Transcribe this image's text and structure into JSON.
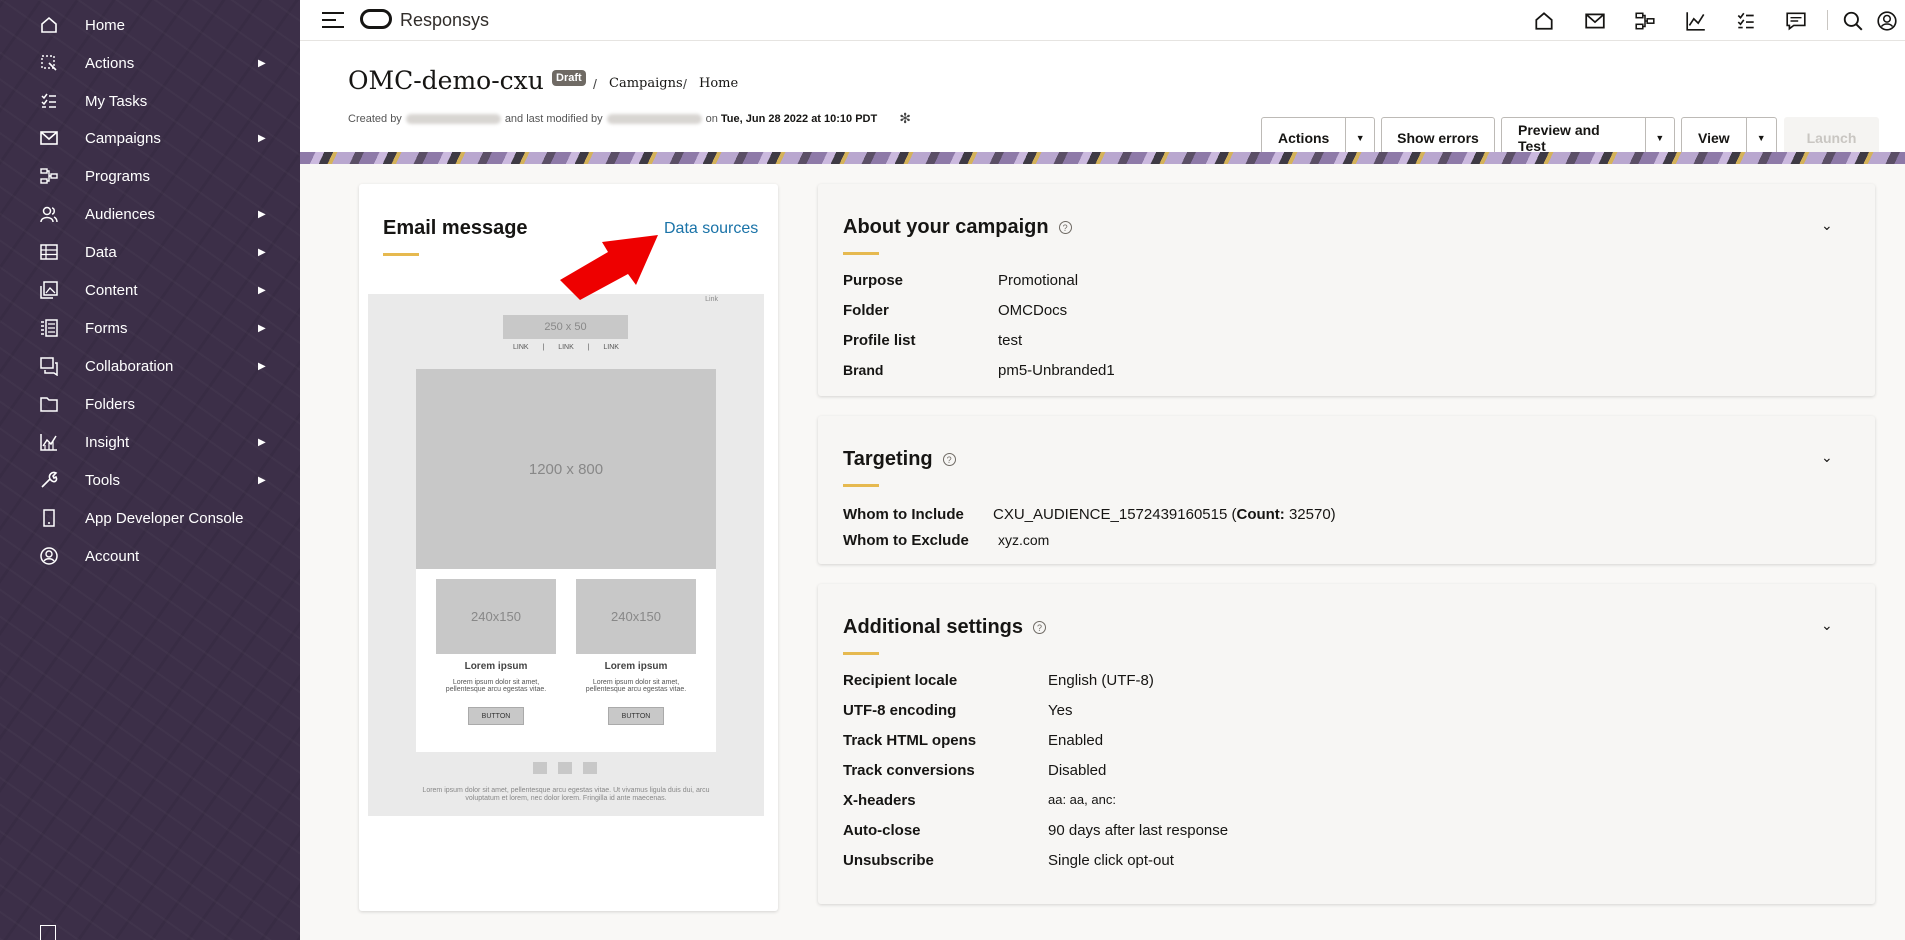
{
  "sidebar": {
    "items": [
      {
        "label": "Home",
        "icon": "home-icon",
        "submenu": false
      },
      {
        "label": "Actions",
        "icon": "actions-icon",
        "submenu": true
      },
      {
        "label": "My Tasks",
        "icon": "tasks-icon",
        "submenu": false
      },
      {
        "label": "Campaigns",
        "icon": "mail-icon",
        "submenu": true
      },
      {
        "label": "Programs",
        "icon": "programs-icon",
        "submenu": false
      },
      {
        "label": "Audiences",
        "icon": "audiences-icon",
        "submenu": true
      },
      {
        "label": "Data",
        "icon": "data-icon",
        "submenu": true
      },
      {
        "label": "Content",
        "icon": "content-icon",
        "submenu": true
      },
      {
        "label": "Forms",
        "icon": "forms-icon",
        "submenu": true
      },
      {
        "label": "Collaboration",
        "icon": "collaboration-icon",
        "submenu": true
      },
      {
        "label": "Folders",
        "icon": "folder-icon",
        "submenu": false
      },
      {
        "label": "Insight",
        "icon": "insight-icon",
        "submenu": true
      },
      {
        "label": "Tools",
        "icon": "wrench-icon",
        "submenu": true
      },
      {
        "label": "App Developer Console",
        "icon": "device-icon",
        "submenu": false
      },
      {
        "label": "Account",
        "icon": "account-icon",
        "submenu": false
      }
    ]
  },
  "topbar": {
    "brand": "Responsys",
    "icons": [
      "home-icon",
      "mail-icon",
      "programs-icon",
      "insight-icon",
      "tasks-icon",
      "chat-icon",
      "search-icon",
      "user-icon"
    ]
  },
  "header": {
    "title": "OMC-demo-cxu",
    "badge": "Draft",
    "breadcrumb_1": "Campaigns",
    "breadcrumb_2": "Home",
    "meta_created": "Created by",
    "meta_modified": "and last modified by",
    "meta_on": "on",
    "meta_date": "Tue, Jun 28 2022 at 10:10 PDT",
    "buttons": {
      "actions": "Actions",
      "show_errors": "Show errors",
      "preview_test": "Preview and Test",
      "view": "View",
      "launch": "Launch"
    }
  },
  "email_card": {
    "title": "Email message",
    "link": "Data sources",
    "preview": {
      "link_tiny": "Link",
      "logo": "250 x 50",
      "nav_links": [
        "LINK",
        "|",
        "LINK",
        "|",
        "LINK"
      ],
      "hero": "1200 x 800",
      "col1_img": "240x150",
      "col2_img": "240x150",
      "col_title": "Lorem ipsum",
      "col_text": "Lorem ipsum dolor sit amet, pellentesque arcu egestas vitae.",
      "col_button": "BUTTON",
      "footer_text": "Lorem ipsum dolor sit amet, pellentesque arcu egestas vitae. Ut vivamus ligula duis dui, arcu voluptatum et lorem, nec dolor lorem. Fringilla id ante maecenas."
    }
  },
  "about_card": {
    "title": "About your campaign",
    "rows": [
      {
        "label": "Purpose",
        "value": "Promotional"
      },
      {
        "label": "Folder",
        "value": "OMCDocs"
      },
      {
        "label": "Profile list",
        "value": "test"
      },
      {
        "label": "Brand",
        "value": "pm5-Unbranded1"
      }
    ]
  },
  "targeting_card": {
    "title": "Targeting",
    "include_label": "Whom to Include",
    "include_value": "CXU_AUDIENCE_1572439160515 (",
    "count_label": "Count:",
    "count_value": " 32570)",
    "exclude_label": "Whom to Exclude",
    "exclude_value": "xyz.com"
  },
  "settings_card": {
    "title": "Additional settings",
    "rows": [
      {
        "label": "Recipient locale",
        "value": "English (UTF-8)"
      },
      {
        "label": "UTF-8 encoding",
        "value": "Yes"
      },
      {
        "label": "Track HTML opens",
        "value": "Enabled"
      },
      {
        "label": "Track conversions",
        "value": "Disabled"
      },
      {
        "label": "X-headers",
        "value": "aa: aa, anc:"
      },
      {
        "label": "Auto-close",
        "value": "90 days after last response"
      },
      {
        "label": "Unsubscribe",
        "value": "Single click opt-out"
      }
    ]
  },
  "colors": {
    "sidebar_bg": "#3c2f48",
    "accent": "#e6b94f",
    "link": "#1a73a8",
    "arrow": "#ee0000"
  }
}
